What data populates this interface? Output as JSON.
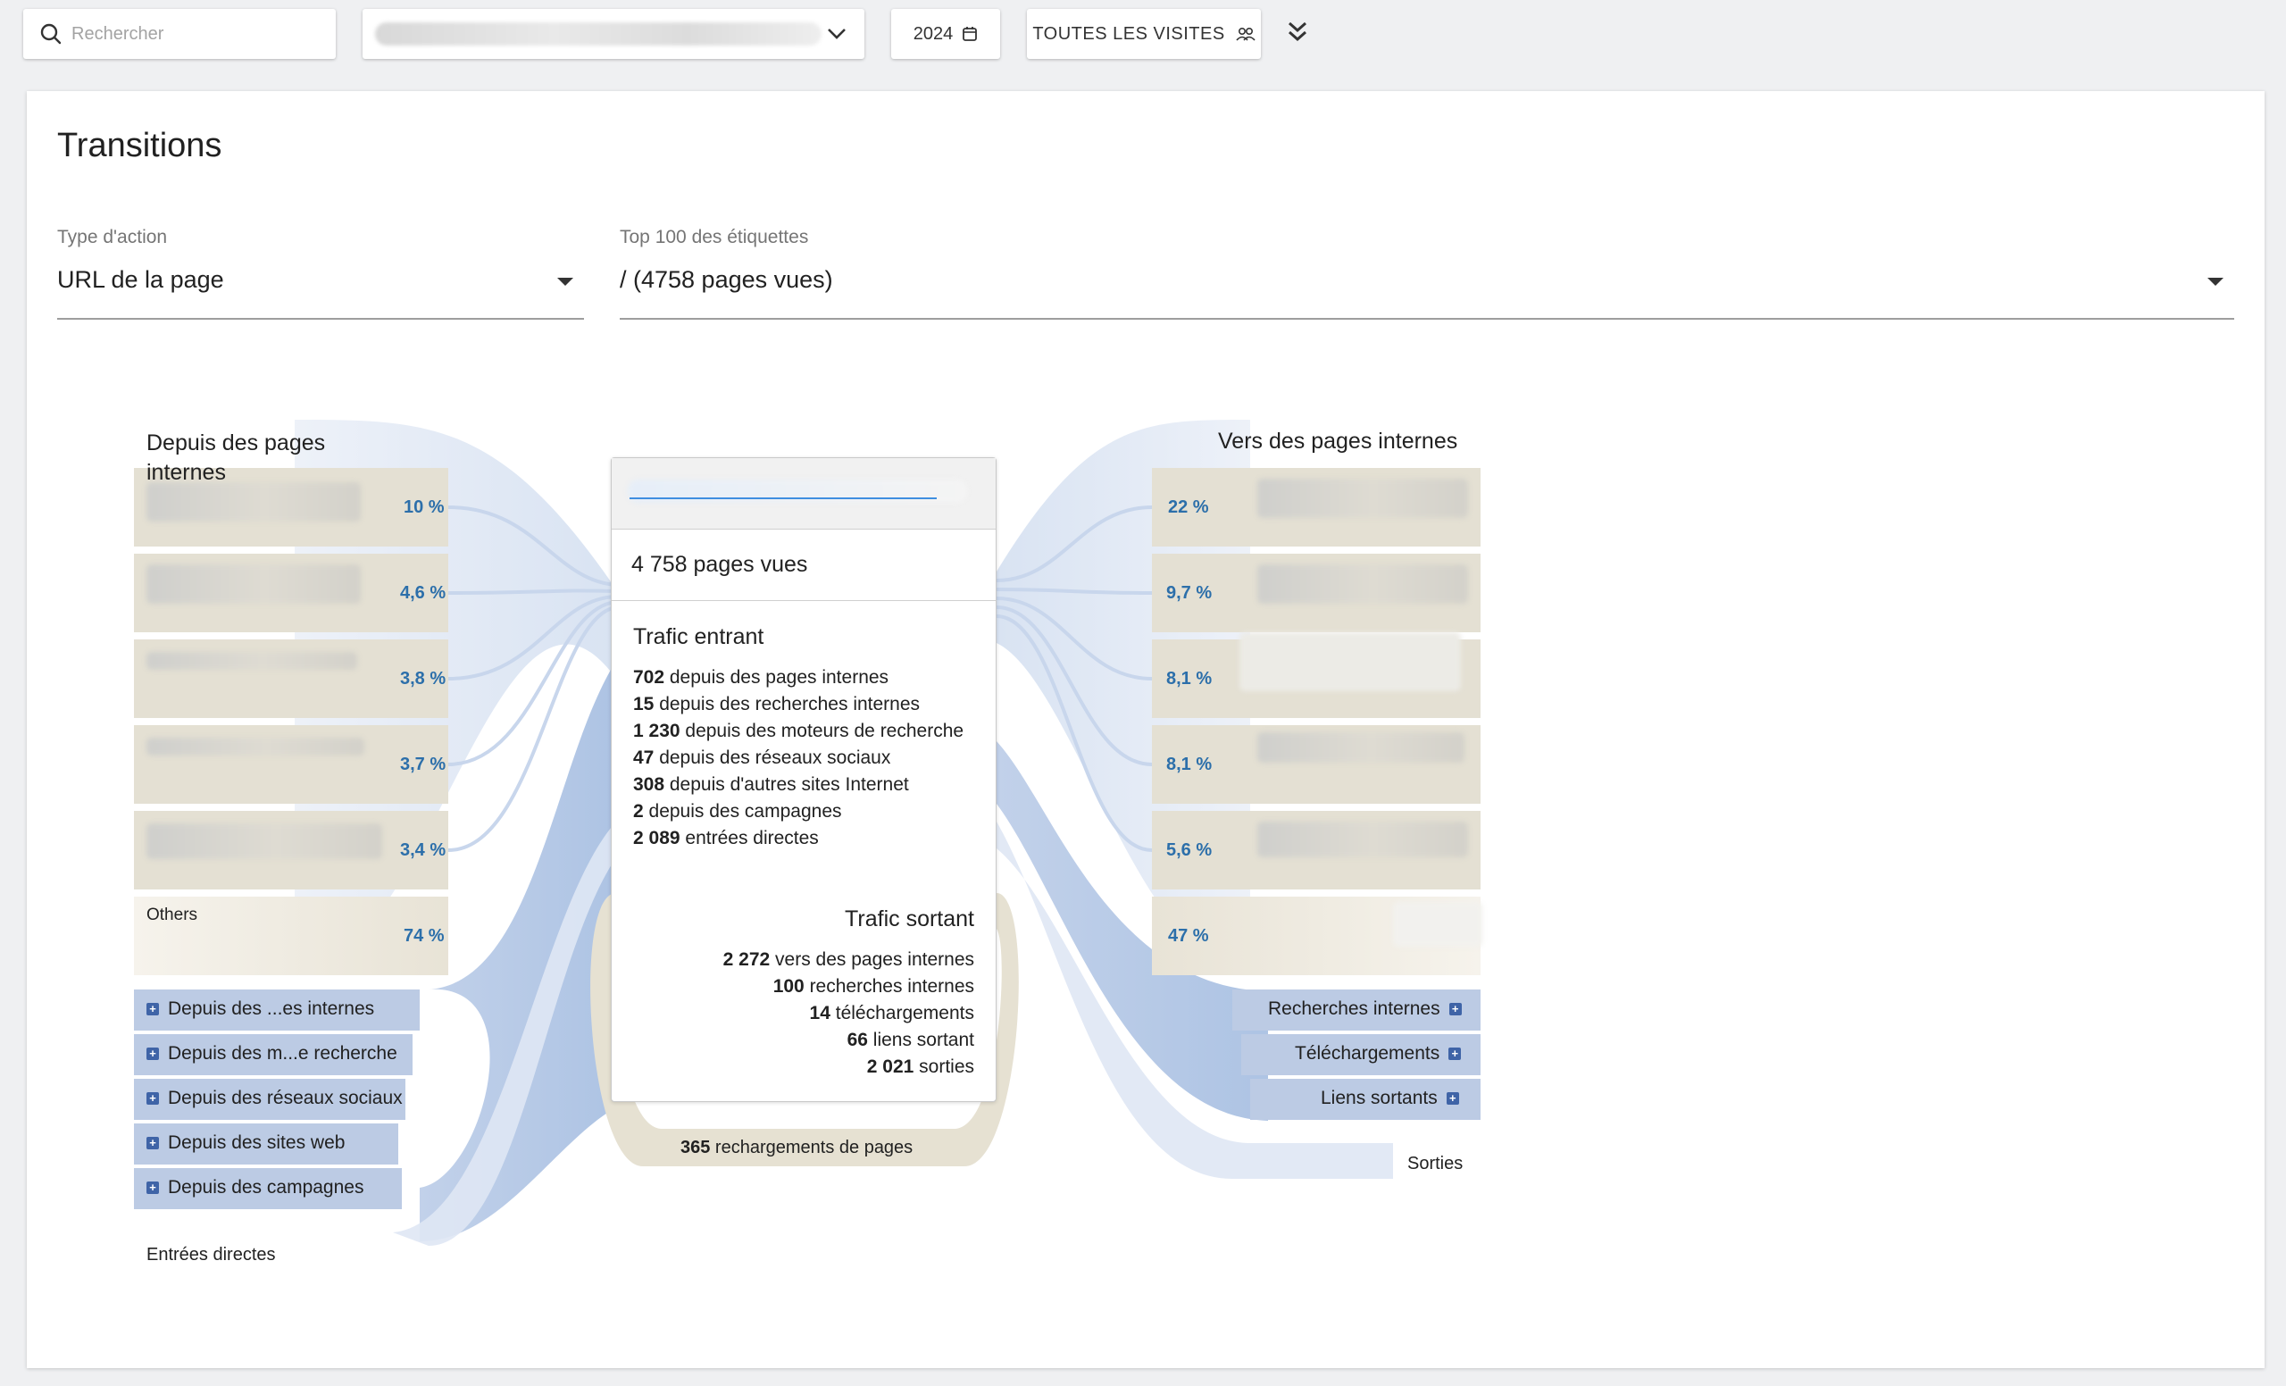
{
  "toolbar": {
    "search_placeholder": "Rechercher",
    "period_label": "2024",
    "segment_label": "TOUTES LES VISITES"
  },
  "card": {
    "title": "Transitions",
    "action_type": {
      "label": "Type d'action",
      "value": "URL de la page"
    },
    "labels": {
      "label": "Top 100 des étiquettes",
      "value": "/ (4758 pages vues)"
    }
  },
  "left": {
    "header_line1": "Depuis des pages",
    "header_line2": "internes",
    "rows": [
      {
        "pct": "10 %"
      },
      {
        "pct": "4,6 %"
      },
      {
        "pct": "3,8 %"
      },
      {
        "pct": "3,7 %"
      },
      {
        "pct": "3,4 %"
      },
      {
        "label": "Others",
        "pct": "74 %"
      }
    ],
    "groups": [
      "Depuis des ...es internes",
      "Depuis des m...e recherche",
      "Depuis des réseaux sociaux",
      "Depuis des sites web",
      "Depuis des campagnes"
    ],
    "direct": "Entrées directes"
  },
  "right": {
    "header": "Vers des pages internes",
    "rows": [
      {
        "pct": "22 %"
      },
      {
        "pct": "9,7 %"
      },
      {
        "pct": "8,1 %"
      },
      {
        "pct": "8,1 %"
      },
      {
        "pct": "5,6 %"
      },
      {
        "pct": "47 %"
      }
    ],
    "groups": [
      "Recherches internes",
      "Téléchargements",
      "Liens sortants"
    ],
    "exits": "Sorties"
  },
  "center": {
    "views": "4 758 pages vues",
    "incoming_title": "Trafic entrant",
    "incoming": [
      {
        "n": "702",
        "t": " depuis des pages internes"
      },
      {
        "n": "15",
        "t": " depuis des recherches internes"
      },
      {
        "n": "1 230",
        "t": " depuis des moteurs de recherche"
      },
      {
        "n": "47",
        "t": " depuis des réseaux sociaux"
      },
      {
        "n": "308",
        "t": " depuis d'autres sites Internet"
      },
      {
        "n": "2",
        "t": " depuis des campagnes"
      },
      {
        "n": "2 089",
        "t": " entrées directes"
      }
    ],
    "outgoing_title": "Trafic sortant",
    "outgoing": [
      {
        "n": "2 272",
        "t": " vers des pages internes"
      },
      {
        "n": "100",
        "t": " recherches internes"
      },
      {
        "n": "14",
        "t": " téléchargements"
      },
      {
        "n": "66",
        "t": " liens sortant"
      },
      {
        "n": "2 021",
        "t": " sorties"
      }
    ],
    "reload_n": "365",
    "reload_t": " rechargements de pages"
  },
  "colors": {
    "row_bg": "#e4e0d3",
    "flow_light": "#dde6f3",
    "flow_blue": "#a9c1e2",
    "group_bg": "#bccbe4",
    "pct_text": "#2c6faa"
  }
}
